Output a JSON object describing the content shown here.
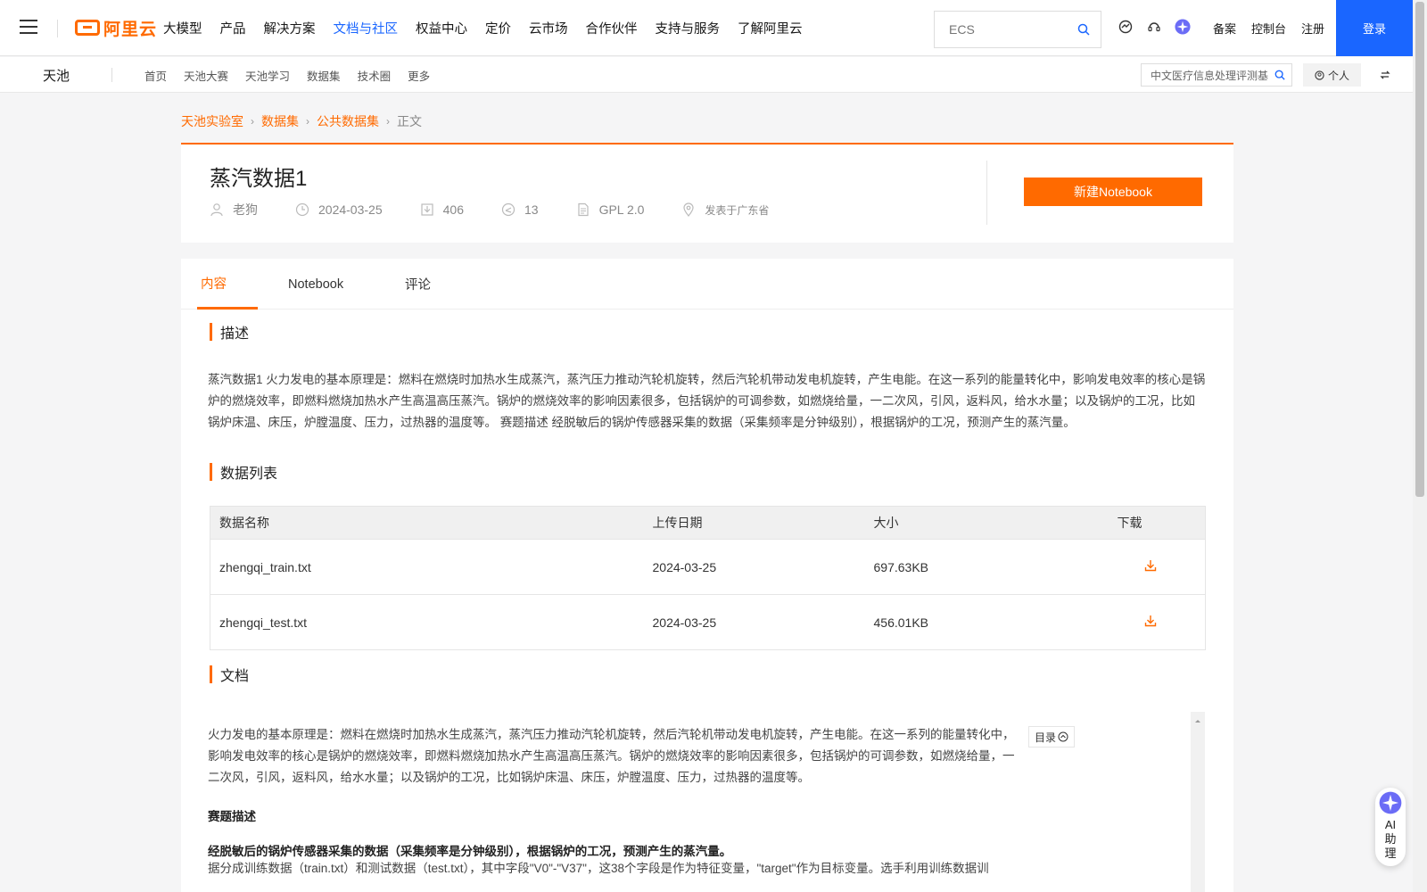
{
  "topnav": {
    "logo_text": "阿里云",
    "items": [
      "大模型",
      "产品",
      "解决方案",
      "文档与社区",
      "权益中心",
      "定价",
      "云市场",
      "合作伙伴",
      "支持与服务",
      "了解阿里云"
    ],
    "active_item": "文档与社区",
    "search_placeholder": "ECS",
    "links": [
      "备案",
      "控制台",
      "注册"
    ],
    "login": "登录"
  },
  "subnav": {
    "brand": "天池",
    "items": [
      "首页",
      "天池大赛",
      "天池学习",
      "数据集",
      "技术圈",
      "更多"
    ],
    "search_value": "中文医疗信息处理评测基",
    "personal": "个人"
  },
  "breadcrumb": {
    "items": [
      "天池实验室",
      "数据集",
      "公共数据集"
    ],
    "current": "正文"
  },
  "dataset": {
    "title": "蒸汽数据1",
    "author": "老狗",
    "date": "2024-03-25",
    "downloads": "406",
    "shares": "13",
    "license": "GPL 2.0",
    "location": "发表于广东省",
    "new_notebook": "新建Notebook"
  },
  "tabs": [
    "内容",
    "Notebook",
    "评论"
  ],
  "sections": {
    "description_title": "描述",
    "description": "蒸汽数据1 火力发电的基本原理是：燃料在燃烧时加热水生成蒸汽，蒸汽压力推动汽轮机旋转，然后汽轮机带动发电机旋转，产生电能。在这一系列的能量转化中，影响发电效率的核心是锅炉的燃烧效率，即燃料燃烧加热水产生高温高压蒸汽。锅炉的燃烧效率的影响因素很多，包括锅炉的可调参数，如燃烧给量，一二次风，引风，返料风，给水水量；以及锅炉的工况，比如锅炉床温、床压，炉膛温度、压力，过热器的温度等。 赛题描述 经脱敏后的锅炉传感器采集的数据（采集频率是分钟级别），根据锅炉的工况，预测产生的蒸汽量。",
    "datalist_title": "数据列表",
    "doc_title": "文档"
  },
  "table": {
    "headers": [
      "数据名称",
      "上传日期",
      "大小",
      "下载"
    ],
    "rows": [
      {
        "name": "zhengqi_train.txt",
        "date": "2024-03-25",
        "size": "697.63KB"
      },
      {
        "name": "zhengqi_test.txt",
        "date": "2024-03-25",
        "size": "456.01KB"
      }
    ]
  },
  "doc": {
    "para1": "火力发电的基本原理是：燃料在燃烧时加热水生成蒸汽，蒸汽压力推动汽轮机旋转，然后汽轮机带动发电机旋转，产生电能。在这一系列的能量转化中，影响发电效率的核心是锅炉的燃烧效率，即燃料燃烧加热水产生高温高压蒸汽。锅炉的燃烧效率的影响因素很多，包括锅炉的可调参数，如燃烧给量，一二次风，引风，返料风，给水水量；以及锅炉的工况，比如锅炉床温、床压，炉膛温度、压力，过热器的温度等。",
    "heading": "赛题描述",
    "bold_line": "经脱敏后的锅炉传感器采集的数据（采集频率是分钟级别），根据锅炉的工况，预测产生的蒸汽量。",
    "para2": "据分成训练数据（train.txt）和测试数据（test.txt），其中字段\"V0\"-\"V37\"，这38个字段是作为特征变量，\"target\"作为目标变量。选手利用训练数据训",
    "toc": "目录"
  },
  "ai_assistant": "AI助理",
  "colors": {
    "accent": "#ff6a00",
    "brand_blue": "#1a66ff"
  }
}
